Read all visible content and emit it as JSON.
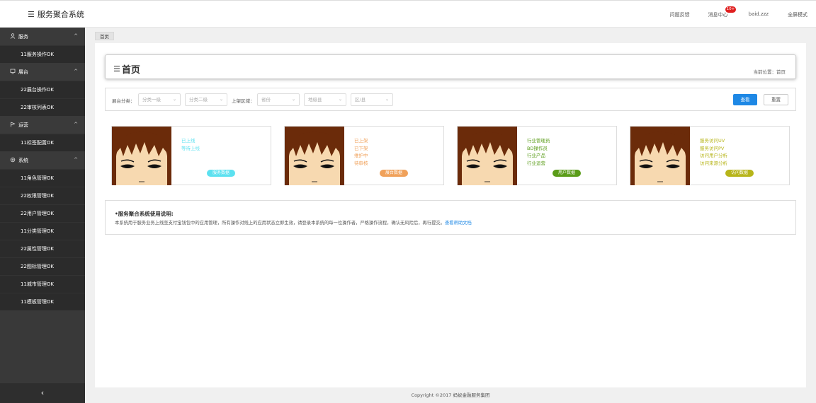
{
  "app": {
    "title": "服务聚合系统",
    "menu_icon": "list-icon"
  },
  "header_nav": {
    "feedback": "问题反馈",
    "messages": "消息中心",
    "messages_badge": "10+",
    "user": "baid.zzz",
    "fullscreen": "全屏模式"
  },
  "sidebar": {
    "groups": [
      {
        "label": "服务",
        "icon": "user-icon",
        "items": [
          "11服务操作OK"
        ]
      },
      {
        "label": "展台",
        "icon": "monitor-icon",
        "items": [
          "22展台操作OK",
          "22审核列表OK"
        ]
      },
      {
        "label": "运营",
        "icon": "flag-icon",
        "items": [
          "11标签配置OK"
        ]
      },
      {
        "label": "系统",
        "icon": "gear-icon",
        "items": [
          "11角色管理OK",
          "22权限管理OK",
          "22用户管理OK",
          "11分类管理OK",
          "22属性管理OK",
          "22图标管理OK",
          "11城市管理OK",
          "11模板管理OK"
        ]
      }
    ],
    "collapse_icon": "chevron-left-icon"
  },
  "tab": {
    "home": "首页"
  },
  "page_header": {
    "title": "首页",
    "location": "当前位置：首页"
  },
  "filters": {
    "category_label": "展台分类：",
    "category_level1": "分类一级",
    "category_level2": "分类二级",
    "region_label": "上架区域：",
    "province": "省份",
    "city": "地级县",
    "district": "区/县",
    "search": "查看",
    "reset": "重置"
  },
  "cards": [
    {
      "lines": [
        "已上线",
        "等待上线"
      ],
      "tag": "服务数据",
      "color": "#5ce1f0"
    },
    {
      "lines": [
        "已上架",
        "已下架",
        "维护中",
        "待审核"
      ],
      "tag": "展台数据",
      "color": "#f0a15a"
    },
    {
      "lines": [
        "行业管理员",
        "BD操作员",
        "行业产品",
        "行业运营"
      ],
      "tag": "用户数据",
      "color": "#5a9c18"
    },
    {
      "lines": [
        "服务访问UV",
        "服务访问PV",
        "访问用户分析",
        "访问来源分析"
      ],
      "tag": "访问数据",
      "color": "#b7b51a"
    }
  ],
  "info": {
    "title": "•服务聚合系统使用说明:",
    "text": "本系统用于服务业务上线至支付宝钱包中的应用管理，所有操作对线上的应用状态立即生效，请登录本系统的每一位操作者，严格操作流程，确认无风险后，再行提交。",
    "link": "查看帮助文档"
  },
  "footer": "Copyright ©2017 蚂蚁金融服务集团"
}
